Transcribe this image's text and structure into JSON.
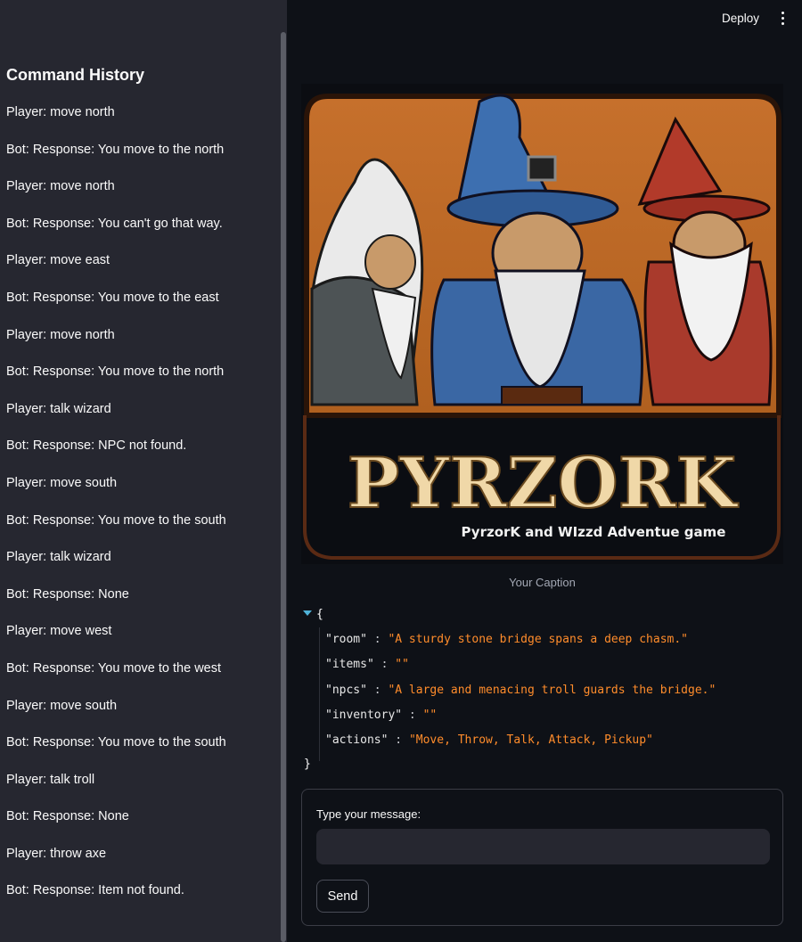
{
  "header": {
    "deploy_label": "Deploy",
    "menu_icon": "vertical-ellipsis-icon"
  },
  "sidebar": {
    "title": "Command History",
    "history": [
      "Player: move north",
      "Bot: Response: You move to the north",
      "Player: move north",
      "Bot: Response: You can't go that way.",
      "Player: move east",
      "Bot: Response: You move to the east",
      "Player: move north",
      "Bot: Response: You move to the north",
      "Player: talk wizard",
      "Bot: Response: NPC not found.",
      "Player: move south",
      "Bot: Response: You move to the south",
      "Player: talk wizard",
      "Bot: Response: None",
      "Player: move west",
      "Bot: Response: You move to the west",
      "Player: move south",
      "Bot: Response: You move to the south",
      "Player: talk troll",
      "Bot: Response: None",
      "Player: throw axe",
      "Bot: Response: Item not found."
    ]
  },
  "hero": {
    "title": "PYRZORK",
    "subtitle": "PyrzorK and WIzzd Adventue game",
    "caption": "Your Caption"
  },
  "state": {
    "open_brace": "{",
    "close_brace": "}",
    "entries": [
      {
        "key": "\"room\"",
        "value": "\"A sturdy stone bridge spans a deep chasm.\""
      },
      {
        "key": "\"items\"",
        "value": "\"\""
      },
      {
        "key": "\"npcs\"",
        "value": "\"A large and menacing troll guards the bridge.\""
      },
      {
        "key": "\"inventory\"",
        "value": "\"\""
      },
      {
        "key": "\"actions\"",
        "value": "\"Move, Throw, Talk, Attack, Pickup\""
      }
    ]
  },
  "form": {
    "label": "Type your message:",
    "input_value": "",
    "send_label": "Send"
  }
}
